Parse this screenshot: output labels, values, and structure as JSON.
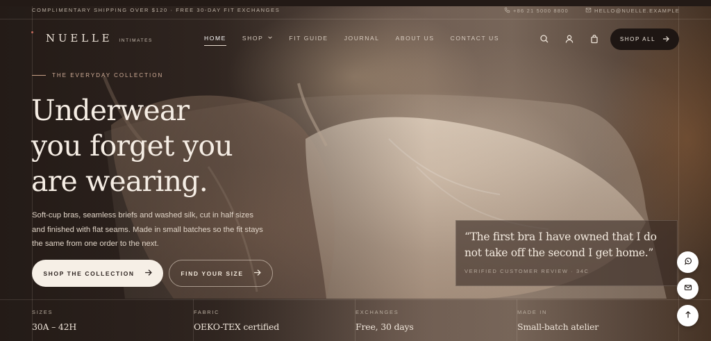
{
  "announcement": "COMPLIMENTARY SHIPPING OVER $120 · FREE 30-DAY FIT EXCHANGES",
  "contact": {
    "phone": "+86 21 5000 8800",
    "email": "HELLO@NUELLE.EXAMPLE",
    "phone_icon": "phone-icon",
    "email_icon": "mail-icon"
  },
  "brand": {
    "name": "NUELLE",
    "sub": "INTIMATES"
  },
  "nav": {
    "items": [
      {
        "label": "HOME",
        "active": true
      },
      {
        "label": "SHOP",
        "has_dropdown": true
      },
      {
        "label": "FIT GUIDE"
      },
      {
        "label": "JOURNAL"
      },
      {
        "label": "ABOUT US"
      },
      {
        "label": "CONTACT US"
      }
    ],
    "icons": [
      "search-icon",
      "user-icon",
      "bag-icon"
    ],
    "cta_label": "SHOP ALL"
  },
  "hero": {
    "eyebrow": "THE EVERYDAY COLLECTION",
    "headline_lines": [
      "Underwear",
      "you forget you",
      "are wearing."
    ],
    "lede": "Soft-cup bras, seamless briefs and washed silk, cut in half sizes and finished with flat seams. Made in small batches so the fit stays the same from one order to the next.",
    "primary_cta": "SHOP THE COLLECTION",
    "secondary_cta": "FIND YOUR SIZE"
  },
  "quote": {
    "text": "“The first bra I have owned that I do not take off the second I get home.”",
    "attribution": "VERIFIED CUSTOMER REVIEW · 34C"
  },
  "stats": [
    {
      "label": "SIZES",
      "value": "30A – 42H"
    },
    {
      "label": "FABRIC",
      "value": "OEKO-TEX certified"
    },
    {
      "label": "EXCHANGES",
      "value": "Free, 30 days"
    },
    {
      "label": "MADE IN",
      "value": "Small-batch atelier"
    }
  ],
  "floating_actions": [
    "whatsapp-icon",
    "mail-icon",
    "arrow-up-icon"
  ],
  "colors": {
    "accent": "#c46a5d",
    "eyebrow": "#d4b09a",
    "dark_button": "#1e1613",
    "light_button": "#f6efe6"
  }
}
